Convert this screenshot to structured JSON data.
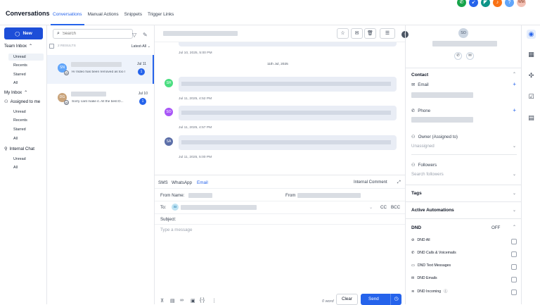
{
  "header": {
    "title": "Conversations",
    "tabs": [
      {
        "label": "Conversations"
      },
      {
        "label": "Manual Actions"
      },
      {
        "label": "Snippets"
      },
      {
        "label": "Trigger Links"
      }
    ],
    "avatar": "WM"
  },
  "nav": {
    "new_label": "New",
    "team_inbox": "Team Inbox",
    "my_inbox": "My Inbox",
    "assigned": "Assigned to me",
    "internal": "Internal Chat",
    "team_items": [
      "Unread",
      "Recents",
      "Starred",
      "All"
    ],
    "assigned_items": [
      "Unread",
      "Recents",
      "Starred",
      "All"
    ],
    "internal_items": [
      "Unread",
      "All"
    ]
  },
  "list": {
    "search_placeholder": "Search",
    "results": "2 RESULTS",
    "sort": "Latest-All",
    "items": [
      {
        "initials": "SN",
        "preview": "Hi Video has been removed as too l",
        "date": "Jul 11",
        "count": "1"
      },
      {
        "initials": "DG",
        "preview": "Sorry cant make it. All the best D...",
        "date": "Jul 10",
        "count": "1"
      }
    ]
  },
  "thread": {
    "times": [
      "Jul 10, 2025, 5:00 PM",
      "Jul 11, 2025, 4:52 PM",
      "Jul 11, 2025, 4:57 PM",
      "Jul 11, 2025, 5:00 PM"
    ],
    "date_sep": "11th Jul, 2025",
    "avatars": [
      "SH",
      "SO",
      "SA"
    ]
  },
  "composer": {
    "tabs": [
      "SMS",
      "WhatsApp",
      "Email"
    ],
    "internal_comment": "Internal Comment",
    "from_name": "From Name:",
    "from": "From",
    "to": "To:",
    "to_chip": "SI",
    "cc": "CC",
    "bcc": "BCC",
    "subject": "Subject:",
    "placeholder": "Type a message",
    "word_count": "0 word",
    "clear": "Clear",
    "send": "Send"
  },
  "contact": {
    "initials": "SO",
    "contact": "Contact",
    "email": "Email",
    "phone": "Phone",
    "owner": "Owner (Assigned to)",
    "unassigned": "Unassigned",
    "followers": "Followers",
    "search_followers": "Search followers",
    "tags": "Tags",
    "automations": "Active Automations",
    "dnd": "DND",
    "dnd_state": "OFF",
    "dnd_items": [
      "DND All",
      "DND Calls & Voicemails",
      "DND Text Messages",
      "DND Emails",
      "DND Incoming"
    ]
  }
}
